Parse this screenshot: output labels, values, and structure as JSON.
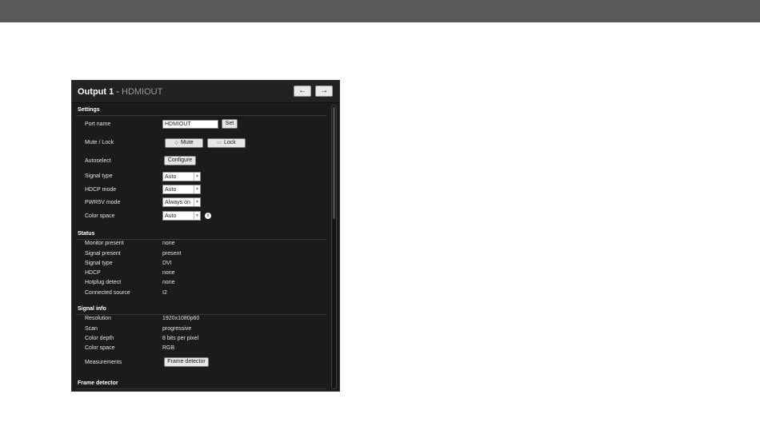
{
  "panel": {
    "title": "Output 1",
    "separator": " - ",
    "subtitle": "HDMIOUT",
    "prev_icon": "←",
    "next_icon": "→"
  },
  "settings": {
    "heading": "Settings",
    "port_name_label": "Port name",
    "port_name_value": "HDMIOUT",
    "set_label": "Set",
    "mute_lock_label": "Mute / Lock",
    "mute_label": "Mute",
    "lock_label": "Lock",
    "autoselect_label": "Autoselect",
    "configure_label": "Configure",
    "signal_type_label": "Signal type",
    "signal_type_value": "Auto",
    "hdcp_mode_label": "HDCP mode",
    "hdcp_mode_value": "Auto",
    "pwr5v_mode_label": "PWR5V mode",
    "pwr5v_mode_value": "Always on",
    "color_space_label": "Color space",
    "color_space_value": "Auto",
    "info_icon_glyph": "i"
  },
  "status": {
    "heading": "Status",
    "rows": [
      {
        "label": "Monitor present",
        "value": "none"
      },
      {
        "label": "Signal present",
        "value": "present"
      },
      {
        "label": "Signal type",
        "value": "DVI"
      },
      {
        "label": "HDCP",
        "value": "none"
      },
      {
        "label": "Hotplug detect",
        "value": "none"
      },
      {
        "label": "Connected source",
        "value": "I2"
      }
    ]
  },
  "signal_info": {
    "heading": "Signal info",
    "rows": [
      {
        "label": "Resolution",
        "value": "1920x1080p60"
      },
      {
        "label": "Scan",
        "value": "progressive"
      },
      {
        "label": "Color depth",
        "value": "8 bits per pixel"
      },
      {
        "label": "Color space",
        "value": "RGB"
      }
    ],
    "measurements_label": "Measurements",
    "frame_detector_button": "Frame detector"
  },
  "frame_detector": {
    "heading": "Frame detector"
  },
  "colors": {
    "topbar": "#595959",
    "panel_bg": "#1b1b1b",
    "text": "#e2e2e2"
  }
}
